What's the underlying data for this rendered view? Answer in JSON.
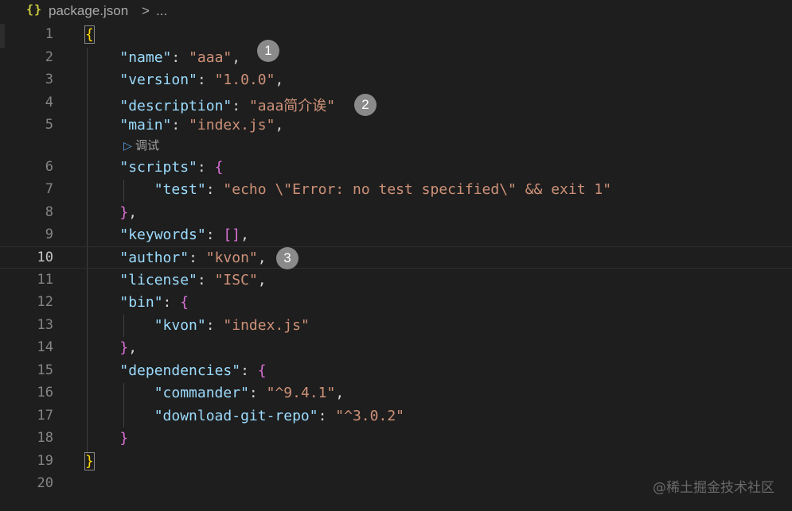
{
  "breadcrumb": {
    "icon": "json-braces-icon",
    "icon_text": "{}",
    "file": "package.json",
    "separator": ">",
    "more": "..."
  },
  "editor": {
    "current_line": 10,
    "codelens_label": "调试",
    "lines": [
      {
        "n": "1",
        "text": "{"
      },
      {
        "n": "2",
        "text": "    \"name\": \"aaa\","
      },
      {
        "n": "3",
        "text": "    \"version\": \"1.0.0\","
      },
      {
        "n": "4",
        "text": "    \"description\": \"aaa简介诶\""
      },
      {
        "n": "5",
        "text": "    \"main\": \"index.js\","
      },
      {
        "n": "6",
        "text": "    \"scripts\": {"
      },
      {
        "n": "7",
        "text": "        \"test\": \"echo \\\"Error: no test specified\\\" && exit 1\""
      },
      {
        "n": "8",
        "text": "    },"
      },
      {
        "n": "9",
        "text": "    \"keywords\": [],"
      },
      {
        "n": "10",
        "text": "    \"author\": \"kvon\","
      },
      {
        "n": "11",
        "text": "    \"license\": \"ISC\","
      },
      {
        "n": "12",
        "text": "    \"bin\": {"
      },
      {
        "n": "13",
        "text": "        \"kvon\": \"index.js\""
      },
      {
        "n": "14",
        "text": "    },"
      },
      {
        "n": "15",
        "text": "    \"dependencies\": {"
      },
      {
        "n": "16",
        "text": "        \"commander\": \"^9.4.1\","
      },
      {
        "n": "17",
        "text": "        \"download-git-repo\": \"^3.0.2\""
      },
      {
        "n": "18",
        "text": "    }"
      },
      {
        "n": "19",
        "text": "}"
      },
      {
        "n": "20",
        "text": ""
      }
    ]
  },
  "badges": [
    "1",
    "2",
    "3"
  ],
  "watermark": "@稀土掘金技术社区"
}
